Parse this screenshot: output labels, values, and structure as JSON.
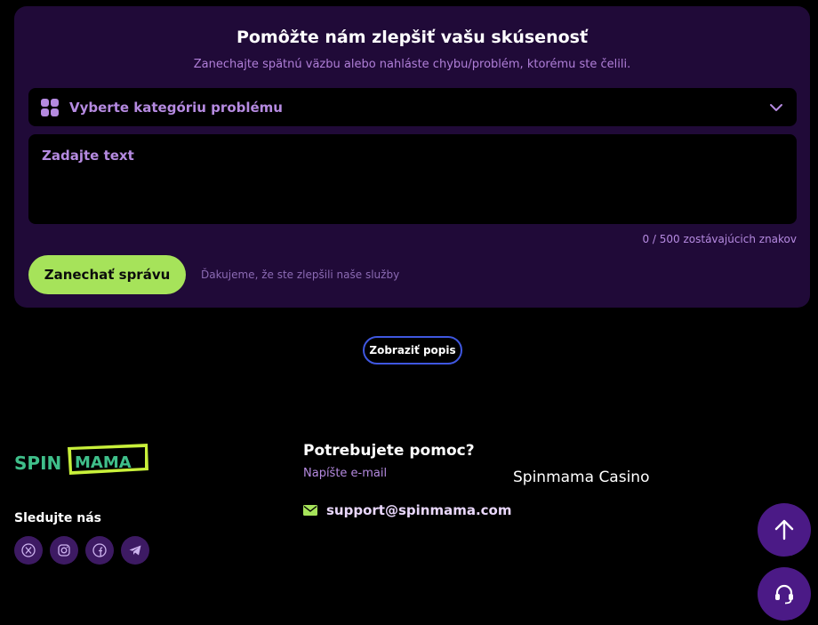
{
  "feedback": {
    "title": "Pomôžte nám zlepšiť vašu skúsenosť",
    "subtitle": "Zanechajte spätnú väzbu alebo nahláste chybu/problém, ktorému ste čelili.",
    "category_placeholder": "Vyberte kategóriu problému",
    "text_placeholder": "Zadajte text",
    "char_counter": "0 / 500 zostávajúcich znakov",
    "submit_label": "Zanechať správu",
    "thanks_text": "Ďakujeme, že ste zlepšili naše služby"
  },
  "show_description_label": "Zobraziť popis",
  "footer": {
    "logo_left": "SPIN",
    "logo_right": "MAMA",
    "follow_label": "Sledujte nás",
    "socials": [
      "x-icon",
      "instagram-icon",
      "facebook-icon",
      "telegram-icon"
    ],
    "help_title": "Potrebujete pomoc?",
    "help_subtitle": "Napíšte e-mail",
    "email": "support@spinmama.com",
    "casino_name": "Spinmama Casino"
  },
  "colors": {
    "card_bg": "#200a38",
    "accent_green": "#a6e35a",
    "accent_purple": "#b58ae0",
    "button_purple": "#4b1a86",
    "outline_blue": "#3f57e0"
  }
}
